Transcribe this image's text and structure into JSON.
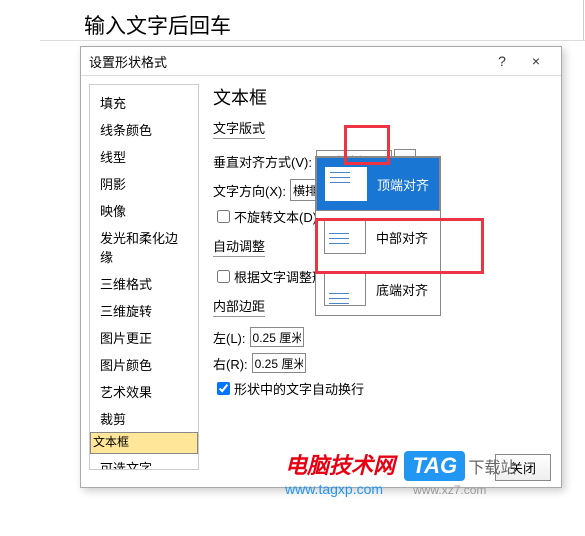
{
  "page_header": "输入文字后回车",
  "dialog": {
    "title": "设置形状格式",
    "help": "?",
    "close": "×",
    "sidebar": [
      "填充",
      "线条颜色",
      "线型",
      "阴影",
      "映像",
      "发光和柔化边缘",
      "三维格式",
      "三维旋转",
      "图片更正",
      "图片颜色",
      "艺术效果",
      "裁剪",
      "文本框",
      "可选文字"
    ],
    "selected_index": 12,
    "main": {
      "title": "文本框",
      "group1": "文字版式",
      "valign_label": "垂直对齐方式(V):",
      "valign_value": "顶端对齐",
      "dir_label": "文字方向(X):",
      "dir_value": "横排",
      "norotate": "不旋转文本(D)",
      "group2": "自动调整",
      "autofit": "根据文字调整形",
      "group3": "内部边距",
      "left_label": "左(L):",
      "left_val": "0.25 厘米",
      "right_label": "右(R):",
      "right_val": "0.25 厘米",
      "wrap": "形状中的文字自动换行",
      "close_btn": "关闭"
    },
    "dropdown": [
      "顶端对齐",
      "中部对齐",
      "底端对齐"
    ],
    "dropdown_selected": 0
  },
  "watermark": {
    "brand": "电脑技术网",
    "tag": "TAG",
    "sub": "下载站",
    "url1": "www.tagxp.com",
    "url2": "www.xz7.com"
  }
}
